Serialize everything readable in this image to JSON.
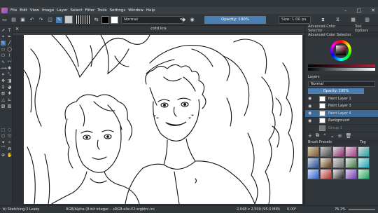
{
  "menubar": {
    "items": [
      "File",
      "Edit",
      "View",
      "Image",
      "Layer",
      "Select",
      "Filter",
      "Tools",
      "Settings",
      "Window",
      "Help"
    ],
    "window_controls": [
      "–",
      "□",
      "✕"
    ]
  },
  "toolbar": {
    "blend_mode": "Normal",
    "opacity": "Opacity: 100%",
    "size": "Size: 1.00 px",
    "fg_color": "#000000",
    "bg_color": "#ffffff"
  },
  "document": {
    "tab_title": "cotd.kra",
    "close_glyph": "✕"
  },
  "dockers": {
    "tabs": [
      "Advanced Color Selector",
      "Tool Options"
    ],
    "color_title": "Advanced Color Selector",
    "layers_title": "Layers",
    "layer_blend": "Normal",
    "layer_opacity": "Opacity:  100%",
    "layers": [
      {
        "name": "Paint Layer 1",
        "active": false
      },
      {
        "name": "Paint Layer 3",
        "active": false
      },
      {
        "name": "Paint Layer 4",
        "active": true
      },
      {
        "name": "Background",
        "active": false
      },
      {
        "name": "Group 1",
        "active": false
      }
    ],
    "presets_title": "Brush Presets",
    "presets_tag": "Tag"
  },
  "statusbar": {
    "brush": "b) Sketching-3 Leaky",
    "color_info": "RGB/Alpha (8-bit integer... sRGB-elle-V2-srgbtrc.icc",
    "size_info": "2,048 x 2,509 (95.0 MiB)",
    "rotation": "0.00°",
    "zoom": "76.2%"
  },
  "colors": {
    "accent": "#4a7fb3",
    "active_layer": "#3c6b99"
  }
}
